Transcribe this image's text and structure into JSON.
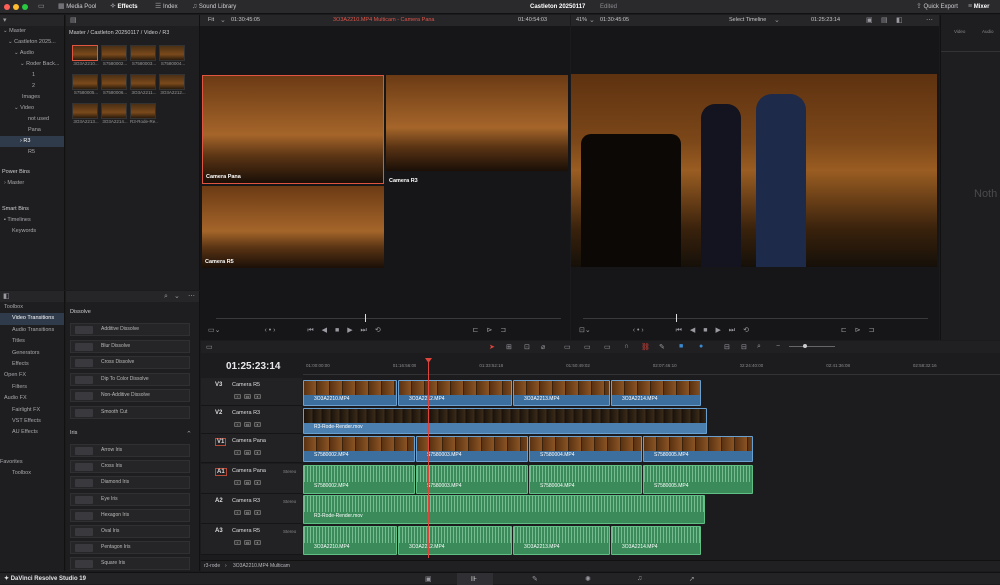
{
  "topbar": {
    "media_pool": "Media Pool",
    "effects": "Effects",
    "index": "Index",
    "sound_library": "Sound Library",
    "project_title": "Castleton 20250117",
    "edited": "Edited",
    "quick_export": "Quick Export",
    "mixer": "Mixer"
  },
  "media_tree": {
    "items": [
      "Master",
      "Castleton 2025...",
      "Audio",
      "Roder Back...",
      "1",
      "2",
      "Images",
      "Video",
      "not used",
      "Pana",
      "R3",
      "R5"
    ],
    "power_bins": "Power Bins",
    "power_master": "Master",
    "smart_bins": "Smart Bins",
    "timelines": "Timelines",
    "keywords": "Keywords"
  },
  "media_pool": {
    "breadcrumb": "Master / Castleton 20250117 / Video / R3",
    "clips": [
      "3O3A2210...",
      "S7580002...",
      "S7580003...",
      "S7580004...",
      "S7580005...",
      "S7580006...",
      "3O3A2211...",
      "3O3A2212...",
      "3O3A2213...",
      "3O3A2214...",
      "R3-Rode-Re..."
    ]
  },
  "source_viewer": {
    "zoom": "Fit",
    "timecode_left": "01:30:45:05",
    "clip_name": "3O3A2210.MP4 Multicam - Camera Pana",
    "timecode_right": "01:40:54:03",
    "angles": [
      "Camera Pana",
      "Camera R3",
      "Camera R5"
    ]
  },
  "timeline_viewer": {
    "zoom": "41%",
    "timecode_left": "01:30:45:05",
    "select": "Select Timeline",
    "timecode_right": "01:25:23:14"
  },
  "inspector": {
    "tabs": [
      "Video",
      "Audio"
    ],
    "empty": "Noth"
  },
  "toolbox": {
    "items": [
      "Toolbox",
      "Video Transitions",
      "Audio Transitions",
      "Titles",
      "Generators",
      "Effects",
      "Open FX",
      "Filters",
      "Audio FX",
      "Fairlight FX",
      "VST Effects",
      "AU Effects",
      "Favorites",
      "Toolbox"
    ]
  },
  "effects_list": {
    "dissolve_header": "Dissolve",
    "dissolve": [
      "Additive Dissolve",
      "Blur Dissolve",
      "Cross Dissolve",
      "Dip To Color Dissolve",
      "Non-Additive Dissolve",
      "Smooth Cut"
    ],
    "iris_header": "Iris",
    "iris": [
      "Arrow Iris",
      "Cross Iris",
      "Diamond Iris",
      "Eye Iris",
      "Hexagon Iris",
      "Oval Iris",
      "Pentagon Iris",
      "Square Iris"
    ]
  },
  "timeline": {
    "timecode": "01:25:23:14",
    "ruler": [
      "01:00:00:00",
      "01:16:56:09",
      "01:33:52:18",
      "01:50:49:02",
      "02:07:46:10",
      "02:24:40:00",
      "02:41:36:08",
      "02:58:32:16",
      "03:15:29:"
    ],
    "tracks": [
      {
        "id": "V3",
        "name": "Camera R5"
      },
      {
        "id": "V2",
        "name": "Camera R3"
      },
      {
        "id": "V1",
        "name": "Camera Pana"
      },
      {
        "id": "A1",
        "name": "Camera Pana",
        "type": "Stereo"
      },
      {
        "id": "A2",
        "name": "Camera R3",
        "type": "Stereo"
      },
      {
        "id": "A3",
        "name": "Camera R5",
        "type": "Stereo"
      }
    ],
    "v3_clips": [
      "3O3A2210.MP4",
      "3O3A2212.MP4",
      "3O3A2213.MP4",
      "3O3A2214.MP4"
    ],
    "v2_clip": "R3-Rode-Render.mov",
    "v1_clips": [
      "S7580002.MP4",
      "S7580003.MP4",
      "S7580004.MP4",
      "S7580005.MP4"
    ],
    "a1_clips": [
      "S7580002.MP4",
      "S7580003.MP4",
      "S7580004.MP4",
      "S7580005.MP4"
    ],
    "a2_clip": "R3-Rode-Render.mov",
    "a3_clips": [
      "3O3A2210.MP4",
      "3O3A2212.MP4",
      "3O3A2213.MP4",
      "3O3A2214.MP4"
    ],
    "bottom_crumb_1": "r3-rode",
    "bottom_crumb_2": "3O3A2210.MP4 Multicam"
  },
  "footer": {
    "app": "DaVinci Resolve Studio 19"
  },
  "colors": {
    "video_clip": "#3d6f9e",
    "audio_clip": "#3a8a5a",
    "playhead": "#e0443a"
  }
}
